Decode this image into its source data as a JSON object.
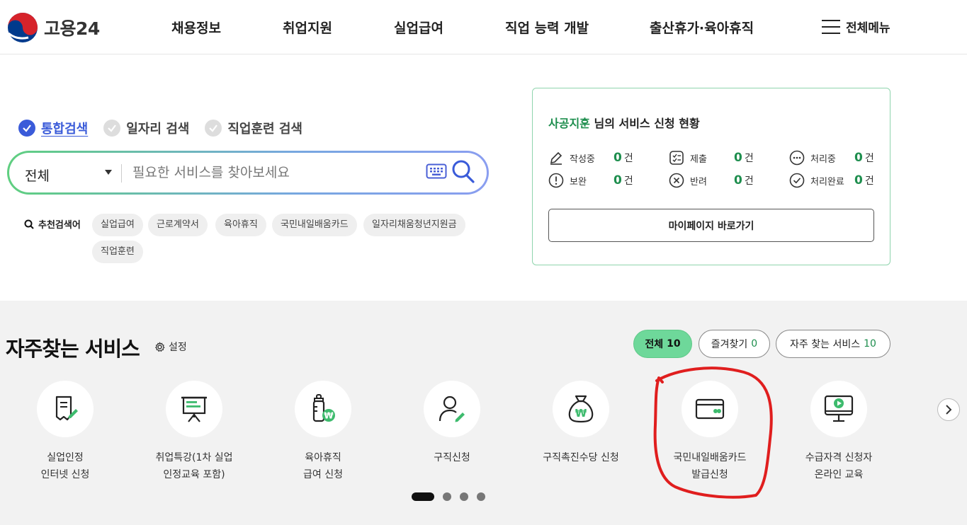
{
  "header": {
    "logo_text": "고용24",
    "nav": [
      "채용정보",
      "취업지원",
      "실업급여",
      "직업 능력 개발",
      "출산휴가·육아휴직"
    ],
    "menu_all": "전체메뉴"
  },
  "search": {
    "tabs": [
      "통합검색",
      "일자리 검색",
      "직업훈련 검색"
    ],
    "active_tab": 0,
    "select_value": "전체",
    "placeholder": "필요한 서비스를 찾아보세요",
    "recommend_label": "추천검색어",
    "recommend": [
      "실업급여",
      "근로계약서",
      "육아휴직",
      "국민내일배움카드",
      "일자리채움청년지원금",
      "직업훈련"
    ]
  },
  "status": {
    "user_name": "사공지훈",
    "title_suffix": "님의 서비스 신청 현황",
    "unit": "건",
    "items": [
      {
        "label": "작성중",
        "count": "0",
        "icon": "pencil-icon"
      },
      {
        "label": "제출",
        "count": "0",
        "icon": "checklist-icon"
      },
      {
        "label": "처리중",
        "count": "0",
        "icon": "ellipsis-circle-icon"
      },
      {
        "label": "보완",
        "count": "0",
        "icon": "exclamation-circle-icon"
      },
      {
        "label": "반려",
        "count": "0",
        "icon": "x-circle-icon"
      },
      {
        "label": "처리완료",
        "count": "0",
        "icon": "check-circle-icon"
      }
    ],
    "mypage_button": "마이페이지 바로가기"
  },
  "services": {
    "title": "자주찾는 서비스",
    "setting": "설정",
    "filters": [
      {
        "label": "전체",
        "count": "10"
      },
      {
        "label": "즐겨찾기",
        "count": "0"
      },
      {
        "label": "자주 찾는 서비스",
        "count": "10"
      }
    ],
    "items": [
      {
        "line1": "실업인정",
        "line2": "인터넷 신청",
        "icon": "document-pen-icon"
      },
      {
        "line1": "취업특강(1차 실업",
        "line2": "인정교육 포함)",
        "icon": "presentation-board-icon"
      },
      {
        "line1": "육아휴직",
        "line2": "급여 신청",
        "icon": "baby-bottle-won-icon"
      },
      {
        "line1": "구직신청",
        "line2": "",
        "icon": "person-pen-icon"
      },
      {
        "line1": "구직촉진수당 신청",
        "line2": "",
        "icon": "money-bag-icon"
      },
      {
        "line1": "국민내일배움카드",
        "line2": "발급신청",
        "icon": "card-icon"
      },
      {
        "line1": "수급자격 신청자",
        "line2": "온라인 교육",
        "icon": "monitor-play-icon"
      }
    ],
    "page_count": 4,
    "active_page": 0
  },
  "colors": {
    "accent_green": "#1e8e4e",
    "accent_blue": "#3a5bd9",
    "annotation_red": "#e01e1e"
  }
}
